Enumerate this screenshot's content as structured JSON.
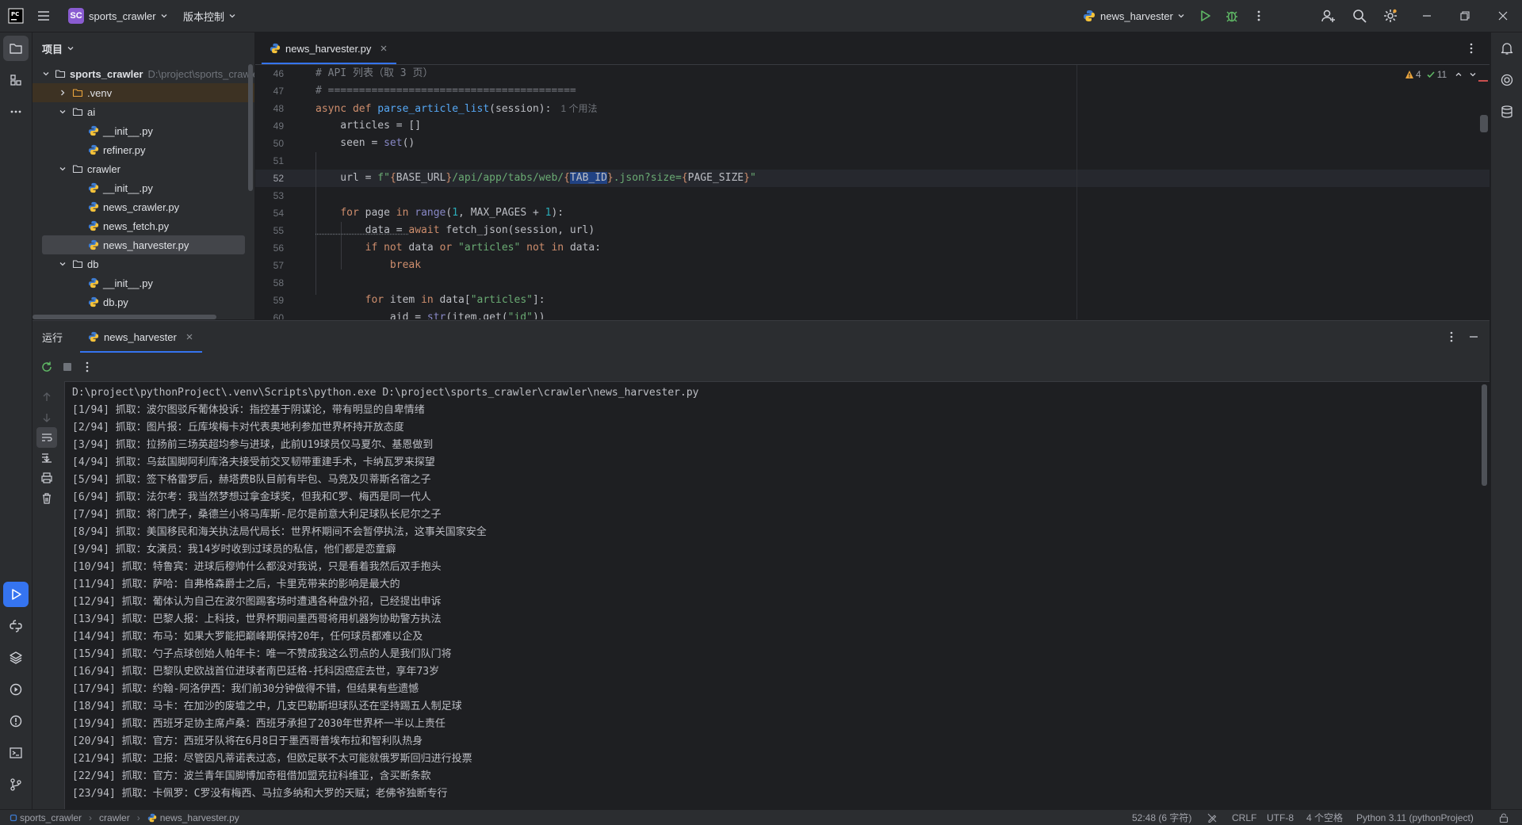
{
  "titlebar": {
    "project_badge": "SC",
    "project_name": "sports_crawler",
    "vcs_label": "版本控制",
    "run_config": "news_harvester"
  },
  "project_panel": {
    "title": "项目",
    "tree": [
      {
        "label": "sports_crawler",
        "path": "D:\\project\\sports_crawler",
        "type": "root",
        "depth": 0,
        "expanded": true
      },
      {
        "label": ".venv",
        "type": "folder",
        "depth": 1,
        "expanded": false
      },
      {
        "label": "ai",
        "type": "folder",
        "depth": 1,
        "expanded": true
      },
      {
        "label": "__init__.py",
        "type": "py",
        "depth": 2
      },
      {
        "label": "refiner.py",
        "type": "py",
        "depth": 2
      },
      {
        "label": "crawler",
        "type": "folder",
        "depth": 1,
        "expanded": true
      },
      {
        "label": "__init__.py",
        "type": "py",
        "depth": 2
      },
      {
        "label": "news_crawler.py",
        "type": "py",
        "depth": 2
      },
      {
        "label": "news_fetch.py",
        "type": "py",
        "depth": 2
      },
      {
        "label": "news_harvester.py",
        "type": "py",
        "depth": 2,
        "selected": true
      },
      {
        "label": "db",
        "type": "folder",
        "depth": 1,
        "expanded": true
      },
      {
        "label": "__init__.py",
        "type": "py",
        "depth": 2
      },
      {
        "label": "db.py",
        "type": "py",
        "depth": 2
      }
    ]
  },
  "editor": {
    "tab_label": "news_harvester.py",
    "inspections": {
      "warnings": "4",
      "ok": "11"
    },
    "line_numbers": [
      "46",
      "47",
      "48",
      "49",
      "50",
      "51",
      "52",
      "53",
      "54",
      "55",
      "56",
      "57",
      "58",
      "59",
      "60"
    ],
    "current_line": "52",
    "code": {
      "l46": "# API 列表（取 3 页）",
      "l47": "# ========================================",
      "l48_kw": "async def ",
      "l48_fn": "parse_article_list",
      "l48_rest": "(session):",
      "l48_hint": "1 个用法",
      "l49": "    articles = []",
      "l50_a": "    seen = ",
      "l50_b": "set",
      "l50_c": "()",
      "l52_a": "    url = ",
      "l52_b": "f\"",
      "l52_c": "{",
      "l52_d": "BASE_URL",
      "l52_e": "}",
      "l52_f": "/api/app/tabs/web/",
      "l52_g": "{",
      "l52_h": "TAB_ID",
      "l52_i": "}",
      "l52_j": ".json?size=",
      "l52_k": "{",
      "l52_l": "PAGE_SIZE",
      "l52_m": "}",
      "l52_n": "\"",
      "l54_a": "    ",
      "l54_b": "for",
      "l54_c": " page ",
      "l54_d": "in",
      "l54_e": " ",
      "l54_f": "range",
      "l54_g": "(",
      "l54_h": "1",
      "l54_i": ", MAX_PAGES + ",
      "l54_j": "1",
      "l54_k": "):",
      "l55_a": "        data = ",
      "l55_b": "await",
      "l55_c": " fetch_json(session, url)",
      "l56_a": "        ",
      "l56_b": "if not",
      "l56_c": " data ",
      "l56_d": "or",
      "l56_e": " ",
      "l56_f": "\"articles\"",
      "l56_g": " ",
      "l56_h": "not in",
      "l56_i": " data:",
      "l57": "            break",
      "l59_a": "        ",
      "l59_b": "for",
      "l59_c": " item ",
      "l59_d": "in",
      "l59_e": " data[",
      "l59_f": "\"articles\"",
      "l59_g": "]:",
      "l60_a": "            aid = ",
      "l60_b": "str",
      "l60_c": "(item.get(",
      "l60_d": "\"id\"",
      "l60_e": "))"
    }
  },
  "run_panel": {
    "title": "运行",
    "tab_label": "news_harvester",
    "command": "D:\\project\\pythonProject\\.venv\\Scripts\\python.exe D:\\project\\sports_crawler\\crawler\\news_harvester.py",
    "lines": [
      "[1/94] 抓取：波尔图驳斥葡体投诉：指控基于阴谋论，带有明显的自卑情绪",
      "[2/94] 抓取：图片报：丘库埃梅卡对代表奥地利参加世界杯持开放态度",
      "[3/94] 抓取：拉扬前三场英超均参与进球，此前U19球员仅马夏尔、基恩做到",
      "[4/94] 抓取：乌兹国脚阿利库洛夫接受前交叉韧带重建手术，卡纳瓦罗来探望",
      "[5/94] 抓取：签下格雷罗后，赫塔费B队目前有毕包、马竞及贝蒂斯名宿之子",
      "[6/94] 抓取：法尔考：我当然梦想过拿金球奖，但我和C罗、梅西是同一代人",
      "[7/94] 抓取：将门虎子，桑德兰小将马库斯-尼尔是前意大利足球队长尼尔之子",
      "[8/94] 抓取：美国移民和海关执法局代局长：世界杯期间不会暂停执法，这事关国家安全",
      "[9/94] 抓取：女演员：我14岁时收到过球员的私信，他们都是恋童癖",
      "[10/94] 抓取：特鲁宾：进球后穆帅什么都没对我说，只是看着我然后双手抱头",
      "[11/94] 抓取：萨哈：自弗格森爵士之后，卡里克带来的影响是最大的",
      "[12/94] 抓取：葡体认为自己在波尔图踢客场时遭遇各种盘外招，已经提出申诉",
      "[13/94] 抓取：巴黎人报：上科技，世界杯期间墨西哥将用机器狗协助警方执法",
      "[14/94] 抓取：布马：如果大罗能把巅峰期保持20年，任何球员都难以企及",
      "[15/94] 抓取：勺子点球创始人帕年卡：唯一不赞成我这么罚点的人是我们队门将",
      "[16/94] 抓取：巴黎队史欧战首位进球者南巴廷格-托科因癌症去世，享年73岁",
      "[17/94] 抓取：约翰-阿洛伊西：我们前30分钟做得不错，但结果有些遗憾",
      "[18/94] 抓取：马卡：在加沙的废墟之中，几支巴勒斯坦球队还在坚持踢五人制足球",
      "[19/94] 抓取：西班牙足协主席卢桑：西班牙承担了2030年世界杯一半以上责任",
      "[20/94] 抓取：官方：西班牙队将在6月8日于墨西哥普埃布拉和智利队热身",
      "[21/94] 抓取：卫报：尽管因凡蒂诺表过态，但欧足联不太可能就俄罗斯回归进行投票",
      "[22/94] 抓取：官方：波兰青年国脚博加奇租借加盟克拉科维亚，含买断条款",
      "[23/94] 抓取：卡佩罗：C罗没有梅西、马拉多纳和大罗的天赋；老佛爷独断专行"
    ]
  },
  "statusbar": {
    "crumb_project": "sports_crawler",
    "crumb_folder": "crawler",
    "crumb_file": "news_harvester.py",
    "position": "52:48 (6 字符)",
    "line_sep": "CRLF",
    "encoding": "UTF-8",
    "indent": "4 个空格",
    "interpreter": "Python 3.11 (pythonProject)"
  },
  "colors": {
    "accent": "#3574f0",
    "project_badge": "#8a5cd1",
    "run_green": "#5fb865",
    "python_blue": "#3d7bd0",
    "python_yellow": "#f5c23a"
  }
}
